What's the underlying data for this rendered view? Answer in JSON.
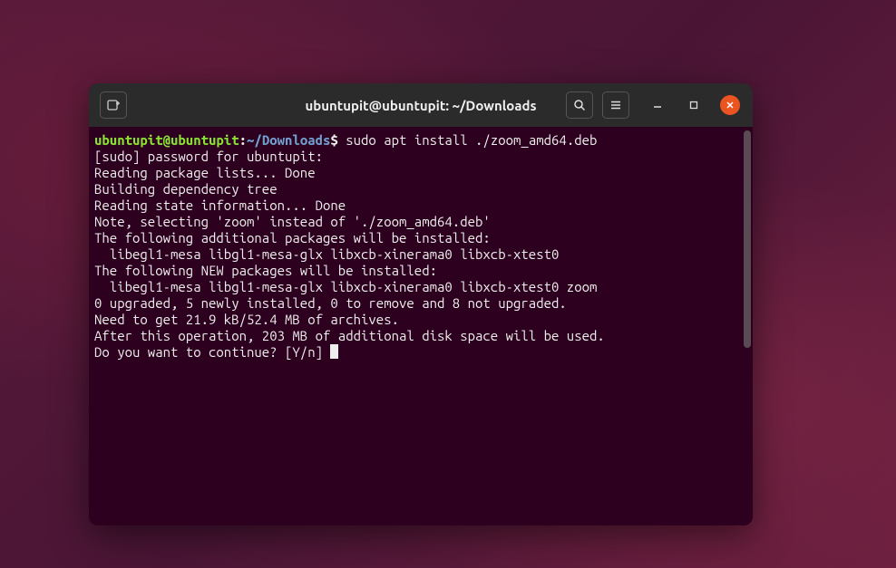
{
  "titlebar": {
    "title": "ubuntupit@ubuntupit: ~/Downloads"
  },
  "prompt": {
    "user_host": "ubuntupit@ubuntupit",
    "separator": ":",
    "path": "~/Downloads",
    "symbol": "$"
  },
  "command": " sudo apt install ./zoom_amd64.deb",
  "output": {
    "l1": "[sudo] password for ubuntupit:",
    "l2": "Reading package lists... Done",
    "l3": "Building dependency tree",
    "l4": "Reading state information... Done",
    "l5": "Note, selecting 'zoom' instead of './zoom_amd64.deb'",
    "l6": "The following additional packages will be installed:",
    "l7": "  libegl1-mesa libgl1-mesa-glx libxcb-xinerama0 libxcb-xtest0",
    "l8": "The following NEW packages will be installed:",
    "l9": "  libegl1-mesa libgl1-mesa-glx libxcb-xinerama0 libxcb-xtest0 zoom",
    "l10": "0 upgraded, 5 newly installed, 0 to remove and 8 not upgraded.",
    "l11": "Need to get 21.9 kB/52.4 MB of archives.",
    "l12": "After this operation, 203 MB of additional disk space will be used.",
    "l13": "Do you want to continue? [Y/n] "
  }
}
